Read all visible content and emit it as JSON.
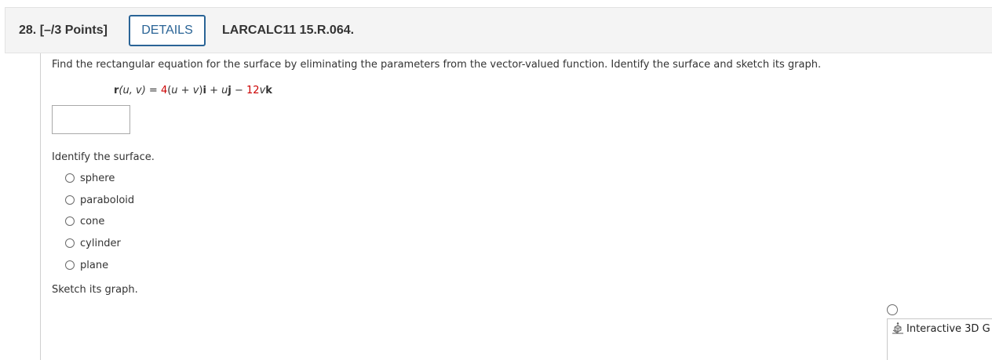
{
  "header": {
    "question_label": "28. [–/3 Points]",
    "details_label": "DETAILS",
    "reference_code": "LARCALC11 15.R.064."
  },
  "question": {
    "prompt": "Find the rectangular equation for the surface by eliminating the parameters from the vector-valued function. Identify the surface and sketch its graph.",
    "equation": {
      "lhs_r": "r",
      "lhs_args": "(u, v)",
      "equals": " = ",
      "coef": "4",
      "paren_open": "(",
      "u1": "u",
      "plus1": " + ",
      "v1": "v",
      "paren_close": ")",
      "i": "i",
      "plus2": " + ",
      "u2": "u",
      "j": "j",
      "minus": " − ",
      "coef2": "12",
      "v2": "v",
      "k": "k"
    },
    "answer_value": "",
    "identify_label": "Identify the surface.",
    "options": [
      "sphere",
      "paraboloid",
      "cone",
      "cylinder",
      "plane"
    ],
    "sketch_label": "Sketch its graph."
  },
  "graph_tool": {
    "icon": "3d-graph-icon",
    "label": "Interactive 3D G"
  },
  "colors": {
    "accent": "#2a6496",
    "red_highlight": "#cc0000",
    "header_bg": "#f4f4f4"
  }
}
